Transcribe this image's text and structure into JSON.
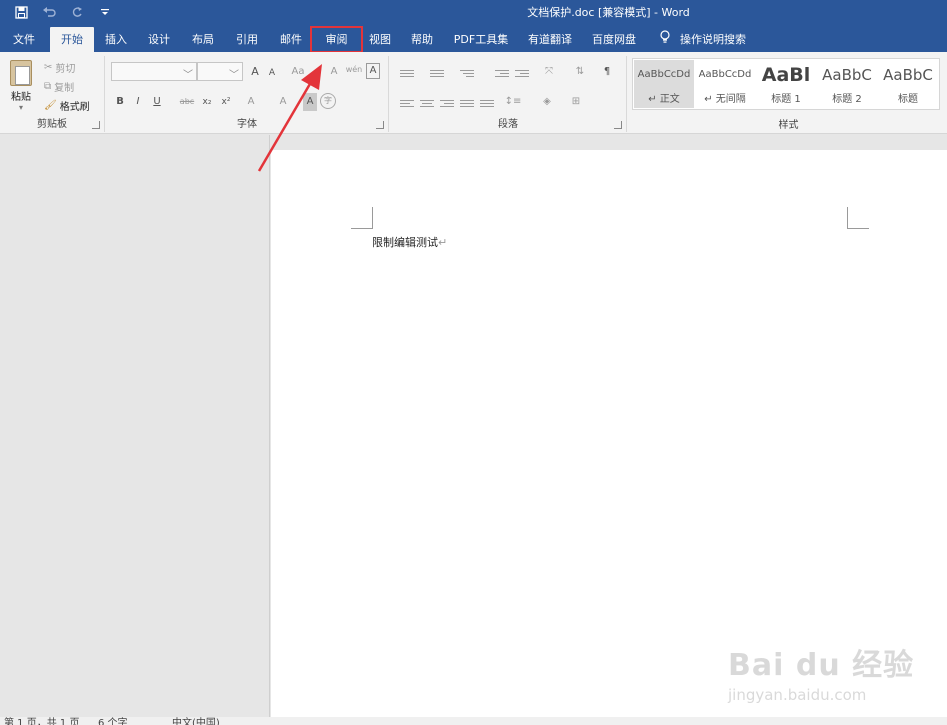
{
  "window": {
    "title": "文档保护.doc [兼容模式]  -  Word"
  },
  "qat": {
    "save_icon": "save-icon",
    "undo_icon": "undo-icon",
    "redo_icon": "redo-icon",
    "customize_icon": "customize-qat-icon"
  },
  "tabs": [
    {
      "label": "文件"
    },
    {
      "label": "开始"
    },
    {
      "label": "插入"
    },
    {
      "label": "设计"
    },
    {
      "label": "布局"
    },
    {
      "label": "引用"
    },
    {
      "label": "邮件"
    },
    {
      "label": "审阅"
    },
    {
      "label": "视图"
    },
    {
      "label": "帮助"
    },
    {
      "label": "PDF工具集"
    },
    {
      "label": "有道翻译"
    },
    {
      "label": "百度网盘"
    }
  ],
  "tell_me": {
    "label": "操作说明搜索"
  },
  "ribbon": {
    "clipboard": {
      "group_label": "剪贴板",
      "paste": "粘贴",
      "cut": "剪切",
      "copy": "复制",
      "format_painter": "格式刷"
    },
    "font": {
      "group_label": "字体",
      "font_name": "",
      "font_size": "",
      "grow": "A",
      "shrink": "A",
      "change_case": "Aa",
      "clear_format": "A",
      "pinyin": "wén",
      "char_border": "A",
      "bold": "B",
      "italic": "I",
      "underline": "U",
      "strikethrough": "abc",
      "subscript": "x₂",
      "superscript": "x²",
      "text_effect": "A",
      "highlight": "ab",
      "font_color": "A",
      "char_shading": "A",
      "enclose": "字"
    },
    "paragraph": {
      "group_label": "段落"
    },
    "styles": {
      "group_label": "样式",
      "items": [
        {
          "sample": "AaBbCcDd",
          "name": "↵ 正文"
        },
        {
          "sample": "AaBbCcDd",
          "name": "↵ 无间隔"
        },
        {
          "sample": "AaBl",
          "name": "标题 1"
        },
        {
          "sample": "AaBbC",
          "name": "标题 2"
        },
        {
          "sample": "AaBbC",
          "name": "标题"
        }
      ]
    }
  },
  "document": {
    "text": "限制编辑测试",
    "para_mark": "↵"
  },
  "status": {
    "page": "第 1 页，共 1 页",
    "words": "6 个字",
    "language": "中文(中国)"
  },
  "watermark": {
    "brand": "Bai du 经验",
    "url": "jingyan.baidu.com"
  },
  "colors": {
    "word_blue": "#2b579a",
    "highlight_red": "#e3343a"
  }
}
